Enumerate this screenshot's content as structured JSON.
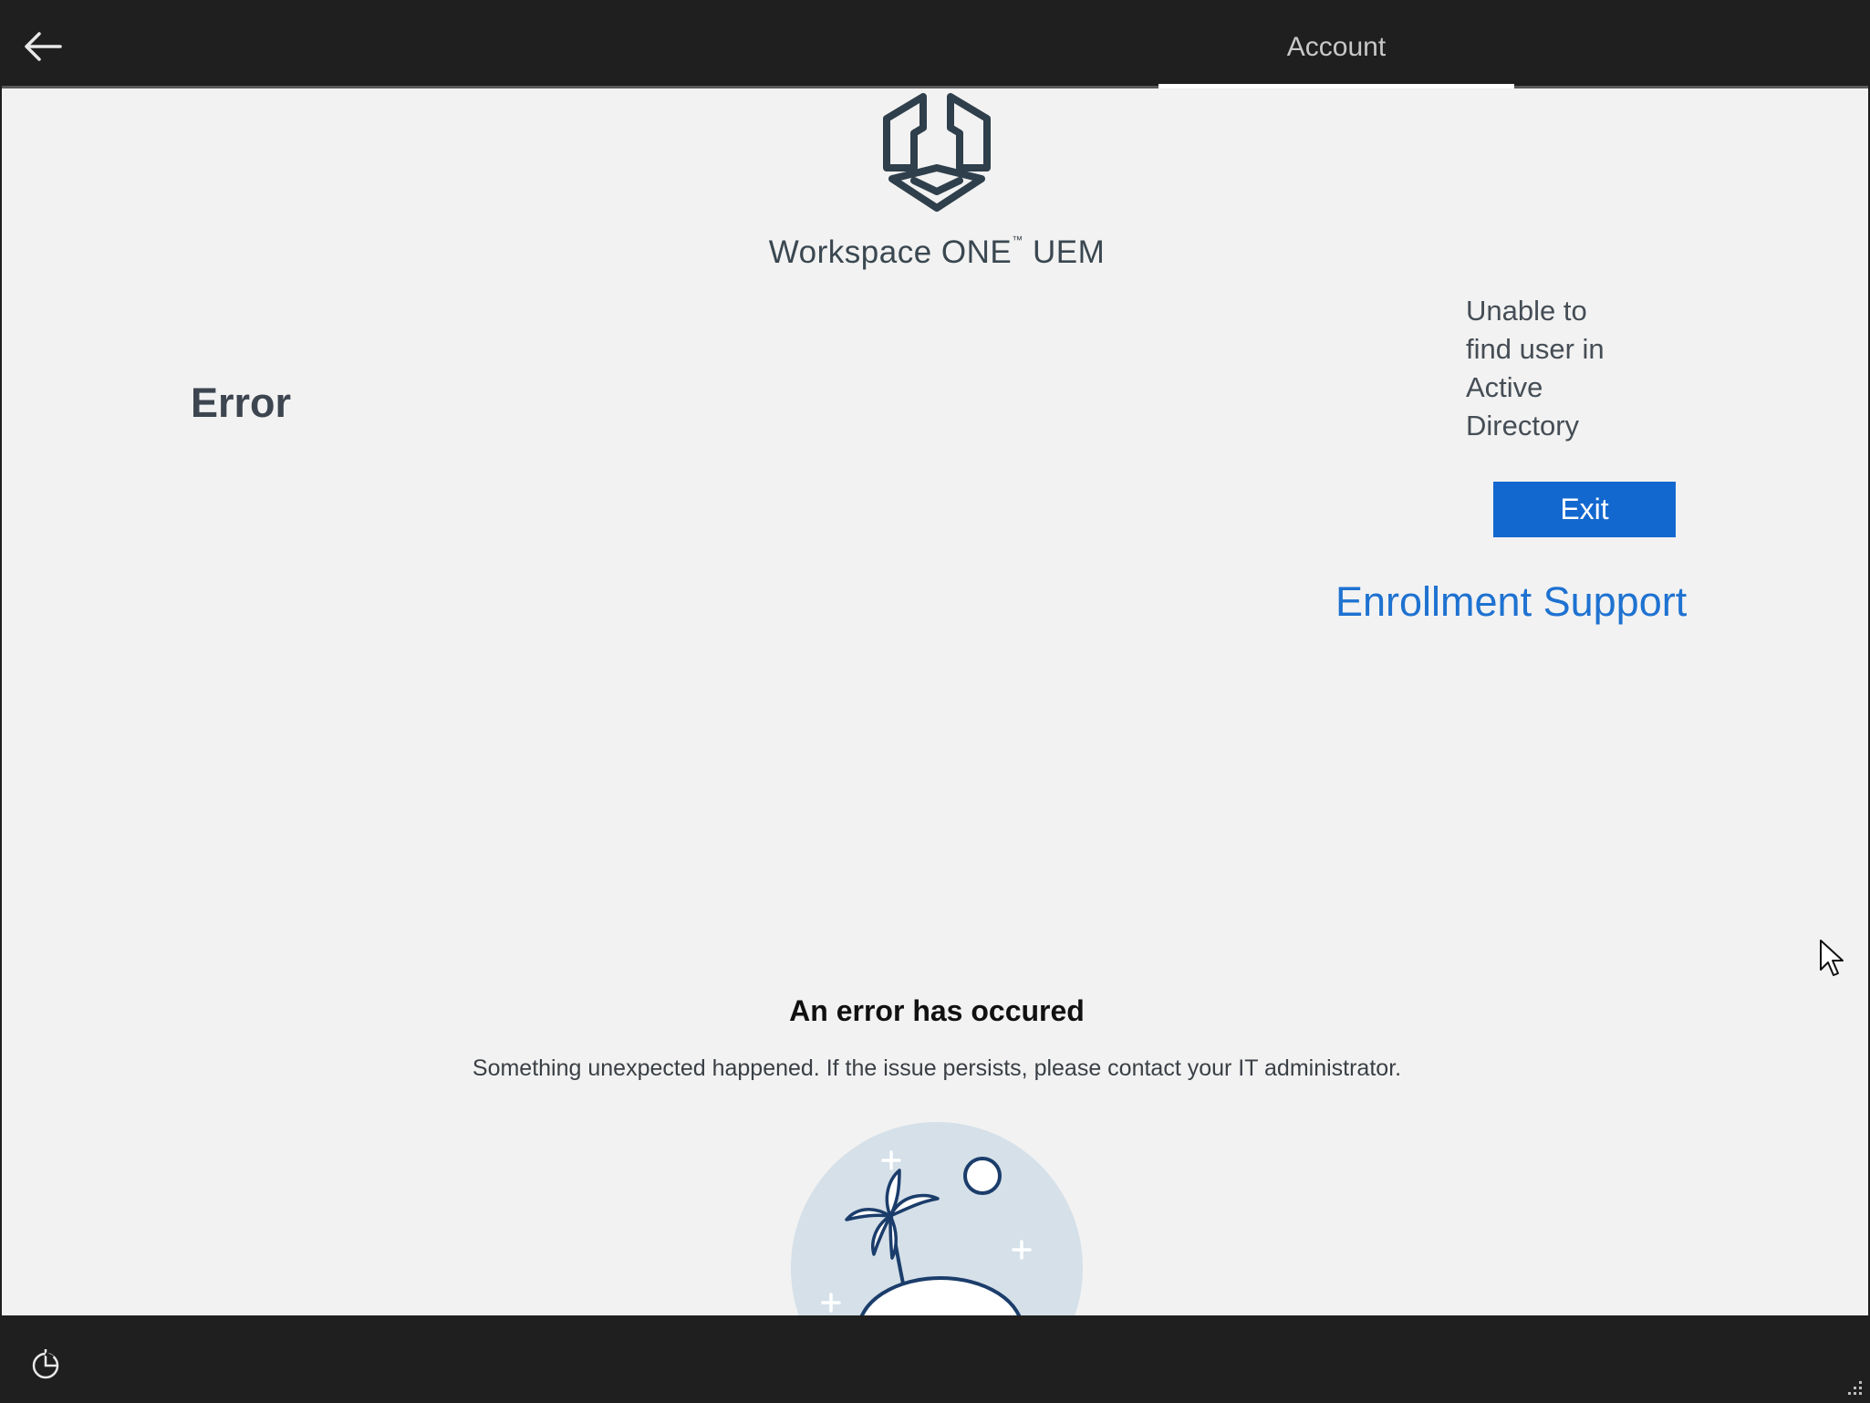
{
  "header": {
    "back_icon": "arrow-left-icon",
    "tab_label": "Account"
  },
  "brand": {
    "logo_icon": "workspace-one-logo",
    "name": "Workspace ONE",
    "trademark": "™",
    "suffix": "UEM"
  },
  "error_panel": {
    "heading": "Error",
    "message": "Unable to find user in Active Directory",
    "exit_label": "Exit",
    "support_link": "Enrollment Support"
  },
  "notice": {
    "title": "An error has occured",
    "description": "Something unexpected happened. If the issue persists, please contact your IT administrator.",
    "illustration": "island-palm-tree-illustration"
  },
  "footer": {
    "ease_of_access_icon": "ease-of-access-icon",
    "resize_icon": "resize-grip-icon"
  },
  "colors": {
    "accent": "#1368cf",
    "link": "#1e72d1",
    "bar": "#1f1f1f",
    "background": "#f2f2f2"
  }
}
